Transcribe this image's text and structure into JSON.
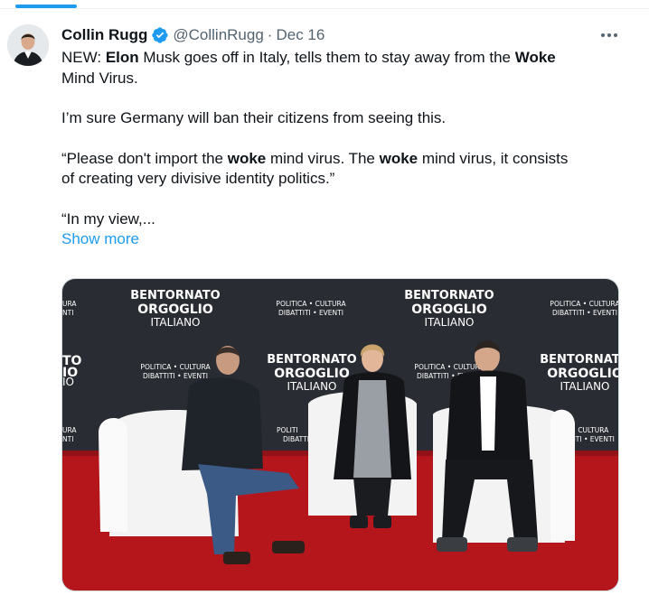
{
  "tweet": {
    "author_name": "Collin Rugg",
    "handle": "@CollinRugg",
    "separator": "·",
    "date": "Dec 16",
    "verified_icon": "verified-badge-icon",
    "more_icon": "more-options-icon",
    "text": {
      "line1_a": "NEW: ",
      "line1_b": "Elon",
      "line1_c": " Musk goes off in Italy, tells them to stay away from the ",
      "line1_d": "Woke",
      "line2": "Mind Virus.",
      "line3": "I’m sure Germany will ban their citizens from seeing this.",
      "line4_a": "“Please don't import the ",
      "line4_b": "woke",
      "line4_c": " mind virus. The ",
      "line4_d": "woke",
      "line4_e": " mind virus, it consists",
      "line5": "of creating very divisive identity politics.”",
      "line6": "“In my view,..."
    },
    "show_more": "Show more"
  },
  "media": {
    "banner_line1": "BENTORNATO",
    "banner_line2": "ORGOGLIO",
    "banner_line3": "ITALIANO",
    "tag_line1": "POLITICA • CULTURA",
    "tag_line2": "DIBATTITI • EVENTI",
    "partial_left_1": "URA",
    "partial_left_2": "NTI",
    "partial_mid_1": "TO",
    "partial_mid_2": "IO",
    "partial_mid_3": "IO",
    "partial_small_1": "POLITI",
    "partial_small_2": "DIBATTI",
    "partial_right_1": "ATTITI • EVENTI",
    "partial_right_2": "A • CULTURA"
  },
  "colors": {
    "accent": "#1d9bf0",
    "text": "#0f1419",
    "secondary": "#536471",
    "backdrop": "#2a2c33",
    "carpet": "#b5161c"
  }
}
